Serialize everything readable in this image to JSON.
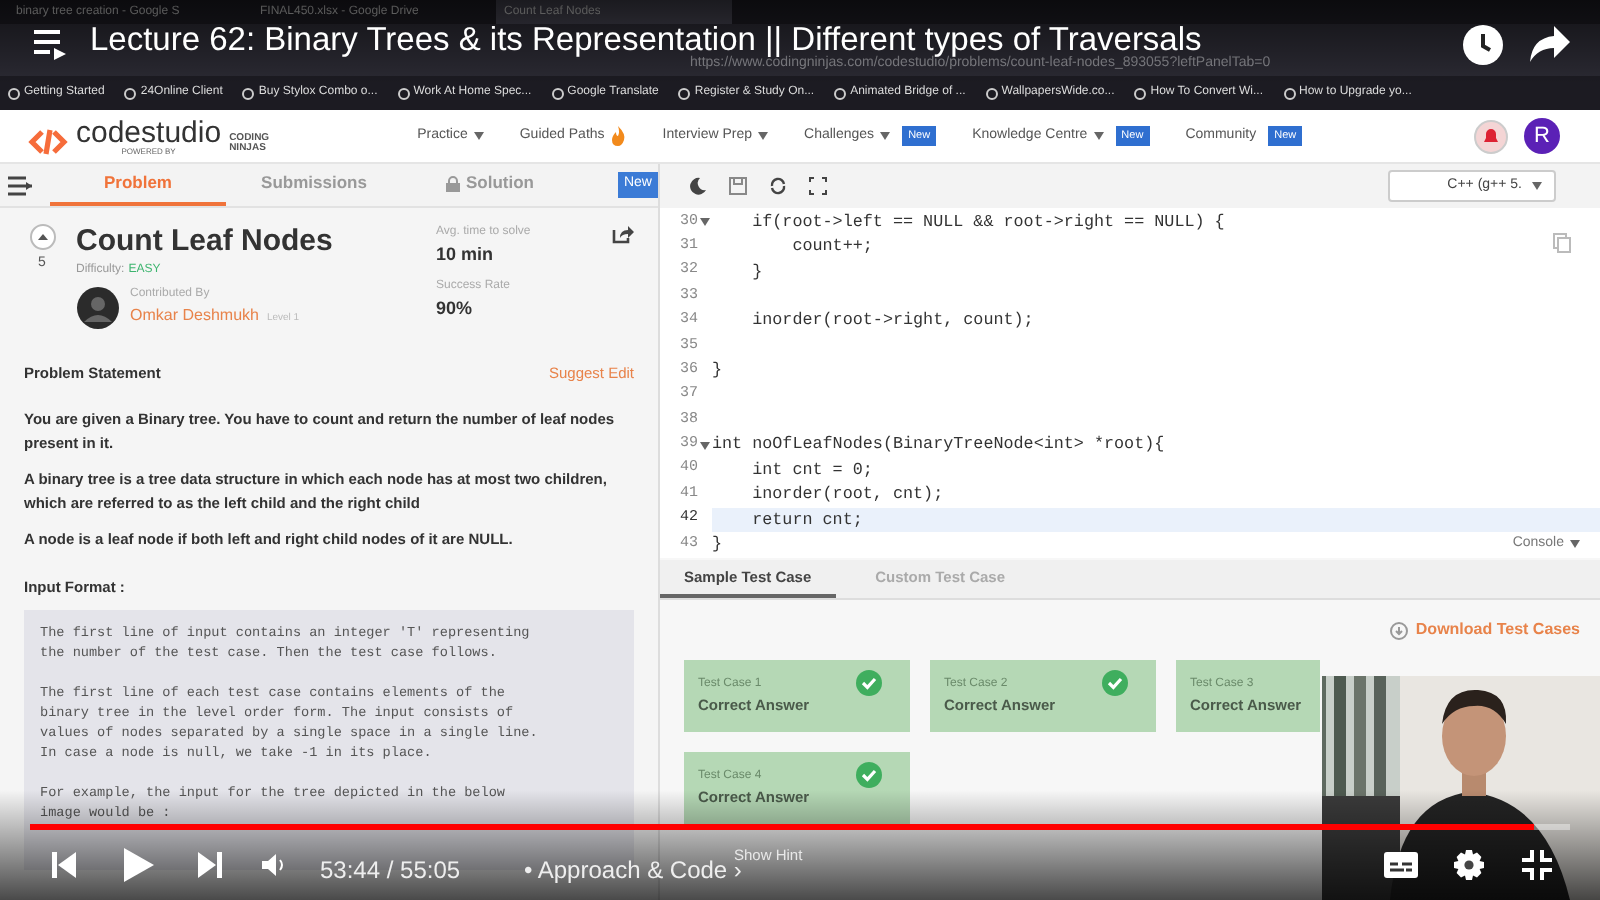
{
  "player": {
    "title": "Lecture 62: Binary Trees & its Representation || Different types of Traversals",
    "time": "53:44 / 55:05",
    "chapter": "• Approach & Code",
    "chapter_arrow": "›",
    "level": 0.977
  },
  "browser": {
    "tabs": [
      {
        "title": "binary tree creation - Google S",
        "selected": false
      },
      {
        "title": "FINAL450.xlsx - Google Drive",
        "selected": false
      },
      {
        "title": "Count Leaf Nodes",
        "selected": true
      }
    ],
    "url": "https://www.codingninjas.com/codestudio/problems/count-leaf-nodes_893055?leftPanelTab=0",
    "bookmarks": [
      "Getting Started",
      "24Online Client",
      "Buy Stylox Combo o...",
      "Work At Home Spec...",
      "Google Translate",
      "Register & Study On...",
      "Animated Bridge of ...",
      "WallpapersWide.co...",
      "How To Convert Wi...",
      "How to Upgrade yo..."
    ]
  },
  "site": {
    "logo": "codestudio",
    "logo_sub": "POWERED BY",
    "logo_brand": "CODING NINJAS",
    "nav": [
      {
        "label": "Practice",
        "kind": "menu"
      },
      {
        "label": "Guided Paths",
        "kind": "fire"
      },
      {
        "label": "Interview Prep",
        "kind": "menu"
      },
      {
        "label": "Challenges",
        "kind": "menu",
        "badge": "New"
      },
      {
        "label": "Knowledge Centre",
        "kind": "menu",
        "badge": "New"
      },
      {
        "label": "Community",
        "kind": "link",
        "badge": "New"
      }
    ],
    "avatar": "R"
  },
  "panel_tabs": [
    {
      "label": "Problem",
      "selected": true,
      "kind": "plain"
    },
    {
      "label": "Submissions",
      "selected": false,
      "kind": "plain"
    },
    {
      "label": "Solution",
      "selected": false,
      "kind": "locked"
    }
  ],
  "panel_badge": "New",
  "problem": {
    "votes": "5",
    "title": "Count Leaf Nodes",
    "difficulty_label": "Difficulty:",
    "difficulty": "EASY",
    "contributed_label": "Contributed By",
    "contributor": "Omkar Deshmukh",
    "contributor_level": "Level 1",
    "avg_label": "Avg. time to solve",
    "avg_value": "10 min",
    "success_label": "Success Rate",
    "success_value": "90%",
    "statement_heading": "Problem Statement",
    "suggest_edit": "Suggest Edit",
    "paragraphs": [
      "You are given a Binary tree. You have to count and return the number of leaf nodes present in it.",
      "A binary tree is a tree data structure in which each node has at most two children, which are referred to as the left child and the right child",
      "A node is a leaf node if both left and right child nodes of it are NULL."
    ],
    "input_heading": "Input Format :",
    "input_blocks": [
      [
        "The first line of input contains an integer 'T' representing",
        "the number of the test case. Then the test case follows."
      ],
      [
        "The first line of each test case contains elements of the",
        "binary tree in the level order form. The input consists of",
        "values of nodes separated by a single space in a single line.",
        "In case a node is null, we take -1 in its place."
      ],
      [
        "For example, the input for the tree depicted in the below",
        "image would be :"
      ]
    ]
  },
  "editor": {
    "language": "C++ (g++ 5.",
    "lines": [
      {
        "number": "30",
        "code": "    if(root->left == NULL && root->right == NULL) {",
        "kind": "foldable",
        "highlighted": false
      },
      {
        "number": "31",
        "code": "        count++;",
        "kind": "plain",
        "highlighted": false
      },
      {
        "number": "32",
        "code": "    }",
        "kind": "plain",
        "highlighted": false
      },
      {
        "number": "33",
        "kind": "plain",
        "highlighted": false
      },
      {
        "number": "34",
        "code": "    inorder(root->right, count);",
        "kind": "plain",
        "highlighted": false
      },
      {
        "number": "35",
        "kind": "plain",
        "highlighted": false
      },
      {
        "number": "36",
        "code": "}",
        "kind": "plain",
        "highlighted": false
      },
      {
        "number": "37",
        "kind": "plain",
        "highlighted": false
      },
      {
        "number": "38",
        "kind": "plain",
        "highlighted": false
      },
      {
        "number": "39",
        "code": "int noOfLeafNodes(BinaryTreeNode<int> *root){",
        "kind": "foldable",
        "highlighted": false
      },
      {
        "number": "40",
        "code": "    int cnt = 0;",
        "kind": "plain",
        "highlighted": false
      },
      {
        "number": "41",
        "code": "    inorder(root, cnt);",
        "kind": "plain",
        "highlighted": false
      },
      {
        "number": "42",
        "code": "    return cnt;",
        "kind": "plain",
        "highlighted": true
      },
      {
        "number": "43",
        "code": "}",
        "kind": "plain",
        "highlighted": false
      }
    ],
    "console": "Console"
  },
  "tests": {
    "tabs": [
      {
        "label": "Sample Test Case",
        "selected": true
      },
      {
        "label": "Custom Test Case",
        "selected": false
      }
    ],
    "download": "Download Test Cases",
    "cases": [
      {
        "label": "Test Case 1",
        "result": "Correct Answer",
        "passed": true
      },
      {
        "label": "Test Case 2",
        "result": "Correct Answer",
        "passed": true
      },
      {
        "label": "Test Case 3",
        "result": "Correct Answer"
      },
      {
        "label": "Test Case 4",
        "result": "Correct Answer",
        "passed": true
      }
    ],
    "hint": "Show Hint"
  }
}
